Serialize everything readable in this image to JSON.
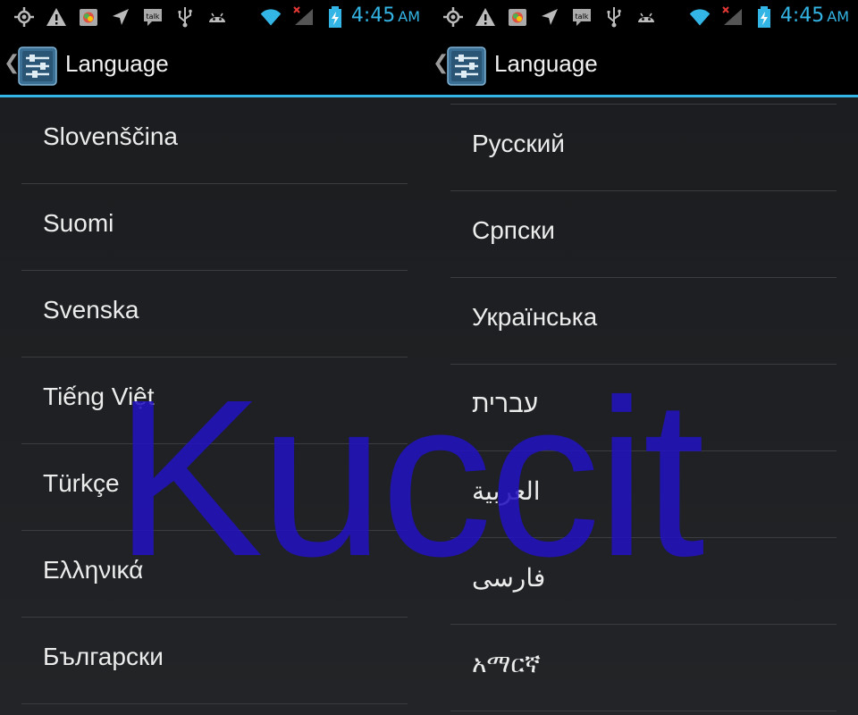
{
  "colors": {
    "accent": "#33b5e5",
    "watermark": "#2212be"
  },
  "screens": [
    {
      "status": {
        "time": "4:45",
        "ampm": "AM"
      },
      "header": {
        "title": "Language"
      },
      "languages": [
        "Slovenščina",
        "Suomi",
        "Svenska",
        "Tiếng Việt",
        "Türkçe",
        "Ελληνικά",
        "Български"
      ]
    },
    {
      "status": {
        "time": "4:45",
        "ampm": "AM"
      },
      "header": {
        "title": "Language"
      },
      "languages": [
        "Русский",
        "Српски",
        "Українська",
        "עברית",
        "العربية",
        "فارسی",
        "አማርኛ"
      ]
    }
  ],
  "watermark": {
    "text": "Kuccit"
  }
}
